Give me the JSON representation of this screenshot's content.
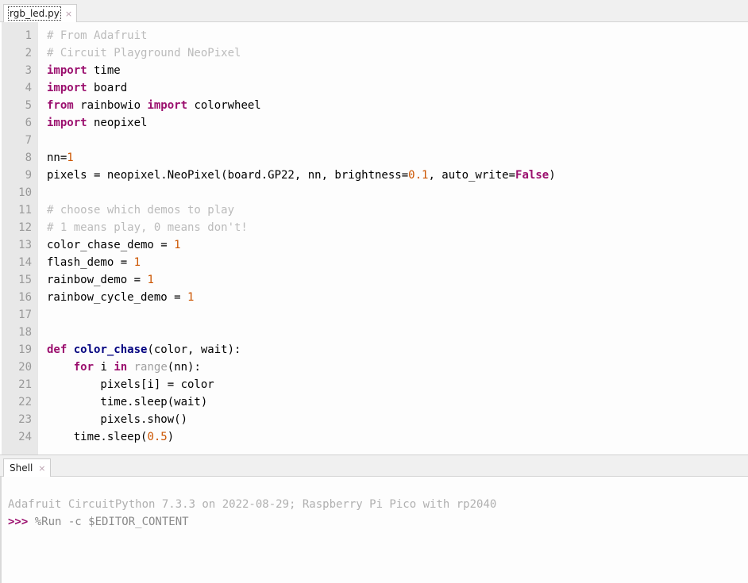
{
  "window": {
    "app_name": "Thonny",
    "colors": {
      "keyword": "#9b0f6e",
      "definition": "#00007f",
      "comment": "#bbbbbb",
      "number": "#cc5500",
      "builtin": "#a0a0a0",
      "gutter_bg": "#e8e8e8",
      "tabbar_bg": "#f0f0f0",
      "editor_bg": "#fdfdfd"
    }
  },
  "editor": {
    "tab": {
      "label": "rgb_led.py",
      "close_icon": "×",
      "focused": true
    },
    "line_numbers": [
      "1",
      "2",
      "3",
      "4",
      "5",
      "6",
      "7",
      "8",
      "9",
      "10",
      "11",
      "12",
      "13",
      "14",
      "15",
      "16",
      "17",
      "18",
      "19",
      "20",
      "21",
      "22",
      "23",
      "24"
    ],
    "lines": [
      {
        "n": 1,
        "tokens": [
          {
            "t": "comment",
            "v": "# From Adafruit"
          }
        ]
      },
      {
        "n": 2,
        "tokens": [
          {
            "t": "comment",
            "v": "# Circuit Playground NeoPixel"
          }
        ]
      },
      {
        "n": 3,
        "tokens": [
          {
            "t": "keyword",
            "v": "import"
          },
          {
            "t": "plain",
            "v": " time"
          }
        ]
      },
      {
        "n": 4,
        "tokens": [
          {
            "t": "keyword",
            "v": "import"
          },
          {
            "t": "plain",
            "v": " board"
          }
        ]
      },
      {
        "n": 5,
        "tokens": [
          {
            "t": "keyword",
            "v": "from"
          },
          {
            "t": "plain",
            "v": " rainbowio "
          },
          {
            "t": "keyword",
            "v": "import"
          },
          {
            "t": "plain",
            "v": " colorwheel"
          }
        ]
      },
      {
        "n": 6,
        "tokens": [
          {
            "t": "keyword",
            "v": "import"
          },
          {
            "t": "plain",
            "v": " neopixel"
          }
        ]
      },
      {
        "n": 7,
        "tokens": []
      },
      {
        "n": 8,
        "tokens": [
          {
            "t": "plain",
            "v": "nn="
          },
          {
            "t": "number",
            "v": "1"
          }
        ]
      },
      {
        "n": 9,
        "tokens": [
          {
            "t": "plain",
            "v": "pixels = neopixel.NeoPixel(board.GP22, nn, brightness="
          },
          {
            "t": "number",
            "v": "0.1"
          },
          {
            "t": "plain",
            "v": ", auto_write="
          },
          {
            "t": "keyword",
            "v": "False"
          },
          {
            "t": "plain",
            "v": ")"
          }
        ]
      },
      {
        "n": 10,
        "tokens": []
      },
      {
        "n": 11,
        "tokens": [
          {
            "t": "comment",
            "v": "# choose which demos to play"
          }
        ]
      },
      {
        "n": 12,
        "tokens": [
          {
            "t": "comment",
            "v": "# 1 means play, 0 means don't!"
          }
        ]
      },
      {
        "n": 13,
        "tokens": [
          {
            "t": "plain",
            "v": "color_chase_demo = "
          },
          {
            "t": "number",
            "v": "1"
          }
        ]
      },
      {
        "n": 14,
        "tokens": [
          {
            "t": "plain",
            "v": "flash_demo = "
          },
          {
            "t": "number",
            "v": "1"
          }
        ]
      },
      {
        "n": 15,
        "tokens": [
          {
            "t": "plain",
            "v": "rainbow_demo = "
          },
          {
            "t": "number",
            "v": "1"
          }
        ]
      },
      {
        "n": 16,
        "tokens": [
          {
            "t": "plain",
            "v": "rainbow_cycle_demo = "
          },
          {
            "t": "number",
            "v": "1"
          }
        ]
      },
      {
        "n": 17,
        "tokens": []
      },
      {
        "n": 18,
        "tokens": []
      },
      {
        "n": 19,
        "tokens": [
          {
            "t": "keyword",
            "v": "def"
          },
          {
            "t": "plain",
            "v": " "
          },
          {
            "t": "definition",
            "v": "color_chase"
          },
          {
            "t": "plain",
            "v": "(color, wait):"
          }
        ]
      },
      {
        "n": 20,
        "tokens": [
          {
            "t": "plain",
            "v": "    "
          },
          {
            "t": "keyword",
            "v": "for"
          },
          {
            "t": "plain",
            "v": " i "
          },
          {
            "t": "keyword",
            "v": "in"
          },
          {
            "t": "plain",
            "v": " "
          },
          {
            "t": "builtin",
            "v": "range"
          },
          {
            "t": "plain",
            "v": "(nn):"
          }
        ]
      },
      {
        "n": 21,
        "tokens": [
          {
            "t": "plain",
            "v": "        pixels[i] = color"
          }
        ]
      },
      {
        "n": 22,
        "tokens": [
          {
            "t": "plain",
            "v": "        time.sleep(wait)"
          }
        ]
      },
      {
        "n": 23,
        "tokens": [
          {
            "t": "plain",
            "v": "        pixels.show()"
          }
        ]
      },
      {
        "n": 24,
        "tokens": [
          {
            "t": "plain",
            "v": "    time.sleep("
          },
          {
            "t": "number",
            "v": "0.5"
          },
          {
            "t": "plain",
            "v": ")"
          }
        ]
      }
    ]
  },
  "shell": {
    "tab": {
      "label": "Shell",
      "close_icon": "×",
      "focused": false
    },
    "lines": [
      {
        "type": "output",
        "segments": [
          {
            "t": "out",
            "v": "Adafruit CircuitPython 7.3.3 on 2022-08-29; Raspberry Pi Pico with rp2040"
          }
        ]
      },
      {
        "type": "prompt",
        "segments": [
          {
            "t": "prompt",
            "v": ">>> "
          },
          {
            "t": "cmd",
            "v": "%Run -c $EDITOR_CONTENT"
          }
        ]
      }
    ]
  }
}
